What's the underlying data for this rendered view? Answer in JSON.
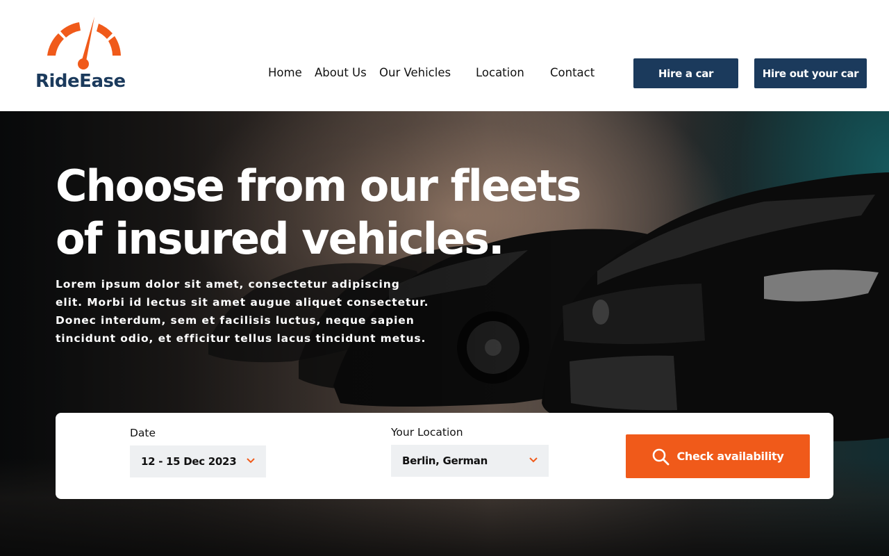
{
  "brand": {
    "name": "RideEase",
    "logo_icon": "speedometer-icon",
    "colors": {
      "navy": "#1b3a5c",
      "orange": "#f05a1a"
    }
  },
  "nav": {
    "items": [
      {
        "label": "Home"
      },
      {
        "label": "About Us"
      },
      {
        "label": "Our Vehicles"
      },
      {
        "label": "Location"
      },
      {
        "label": "Contact"
      }
    ],
    "hire_button": "Hire a car",
    "hire_out_button": "Hire out your car"
  },
  "hero": {
    "title_line1": "Choose from our fleets",
    "title_line2": "of insured vehicles.",
    "description": "Lorem ipsum dolor sit amet, consectetur adipiscing elit. Morbi id lectus sit amet augue aliquet consectetur. Donec interdum, sem et facilisis luctus, neque sapien tincidunt odio, et efficitur tellus lacus tincidunt metus."
  },
  "search": {
    "date_label": "Date",
    "date_value": "12 - 15 Dec 2023",
    "location_label": "Your Location",
    "location_value": "Berlin, German",
    "chevron_icon": "chevron-down-icon",
    "search_icon": "search-icon",
    "check_button": "Check availability"
  }
}
